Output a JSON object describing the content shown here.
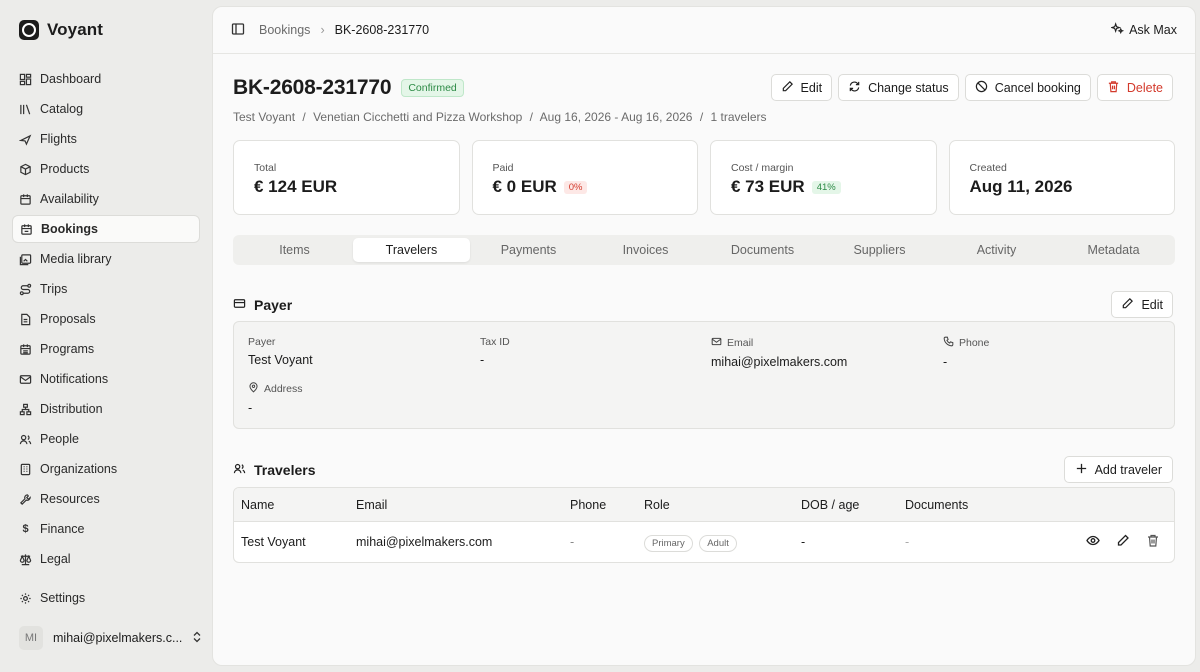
{
  "app": {
    "name": "Voyant"
  },
  "sidebar": {
    "items": [
      {
        "label": "Dashboard",
        "icon": "dashboard-icon"
      },
      {
        "label": "Catalog",
        "icon": "catalog-icon"
      },
      {
        "label": "Flights",
        "icon": "plane-icon"
      },
      {
        "label": "Products",
        "icon": "package-icon"
      },
      {
        "label": "Availability",
        "icon": "calendar-icon"
      },
      {
        "label": "Bookings",
        "icon": "calendar-check-icon",
        "active": true
      },
      {
        "label": "Media library",
        "icon": "image-icon"
      },
      {
        "label": "Trips",
        "icon": "route-icon"
      },
      {
        "label": "Proposals",
        "icon": "file-icon"
      },
      {
        "label": "Programs",
        "icon": "calendar-grid-icon"
      },
      {
        "label": "Notifications",
        "icon": "mail-icon"
      },
      {
        "label": "Distribution",
        "icon": "network-icon"
      },
      {
        "label": "People",
        "icon": "users-icon"
      },
      {
        "label": "Organizations",
        "icon": "building-icon"
      },
      {
        "label": "Resources",
        "icon": "wrench-icon"
      },
      {
        "label": "Finance",
        "icon": "dollar-icon"
      },
      {
        "label": "Legal",
        "icon": "scale-icon"
      }
    ],
    "settings_label": "Settings",
    "user": {
      "initials": "MI",
      "email": "mihai@pixelmakers.c..."
    }
  },
  "topbar": {
    "crumb_parent": "Bookings",
    "crumb_current": "BK-2608-231770",
    "ask_label": "Ask Max"
  },
  "booking": {
    "id": "BK-2608-231770",
    "status": "Confirmed",
    "customer": "Test Voyant",
    "product": "Venetian Cicchetti and Pizza Workshop",
    "dates": "Aug 16, 2026 - Aug 16, 2026",
    "travelers_count": "1 travelers",
    "sep": "/"
  },
  "actions": {
    "edit": "Edit",
    "change_status": "Change status",
    "cancel": "Cancel booking",
    "delete": "Delete"
  },
  "stats": {
    "total": {
      "label": "Total",
      "value": "€ 124 EUR"
    },
    "paid": {
      "label": "Paid",
      "value": "€ 0 EUR",
      "badge": "0%"
    },
    "cost": {
      "label": "Cost / margin",
      "value": "€ 73 EUR",
      "badge": "41%"
    },
    "created": {
      "label": "Created",
      "value": "Aug 11, 2026"
    }
  },
  "tabs": [
    "Items",
    "Travelers",
    "Payments",
    "Invoices",
    "Documents",
    "Suppliers",
    "Activity",
    "Metadata"
  ],
  "active_tab": "Travelers",
  "payer": {
    "title": "Payer",
    "edit_label": "Edit",
    "fields": {
      "payer": {
        "label": "Payer",
        "value": "Test Voyant"
      },
      "tax_id": {
        "label": "Tax ID",
        "value": "-"
      },
      "email": {
        "label": "Email",
        "value": "mihai@pixelmakers.com"
      },
      "phone": {
        "label": "Phone",
        "value": "-"
      },
      "address": {
        "label": "Address",
        "value": "-"
      }
    }
  },
  "travelers": {
    "title": "Travelers",
    "add_label": "Add traveler",
    "columns": [
      "Name",
      "Email",
      "Phone",
      "Role",
      "DOB / age",
      "Documents"
    ],
    "rows": [
      {
        "name": "Test Voyant",
        "email": "mihai@pixelmakers.com",
        "phone": "-",
        "roles": [
          "Primary",
          "Adult"
        ],
        "dob": "-",
        "documents": "-"
      }
    ]
  },
  "colors": {
    "accent_green": "#2c8a45",
    "danger": "#d33a2c"
  }
}
